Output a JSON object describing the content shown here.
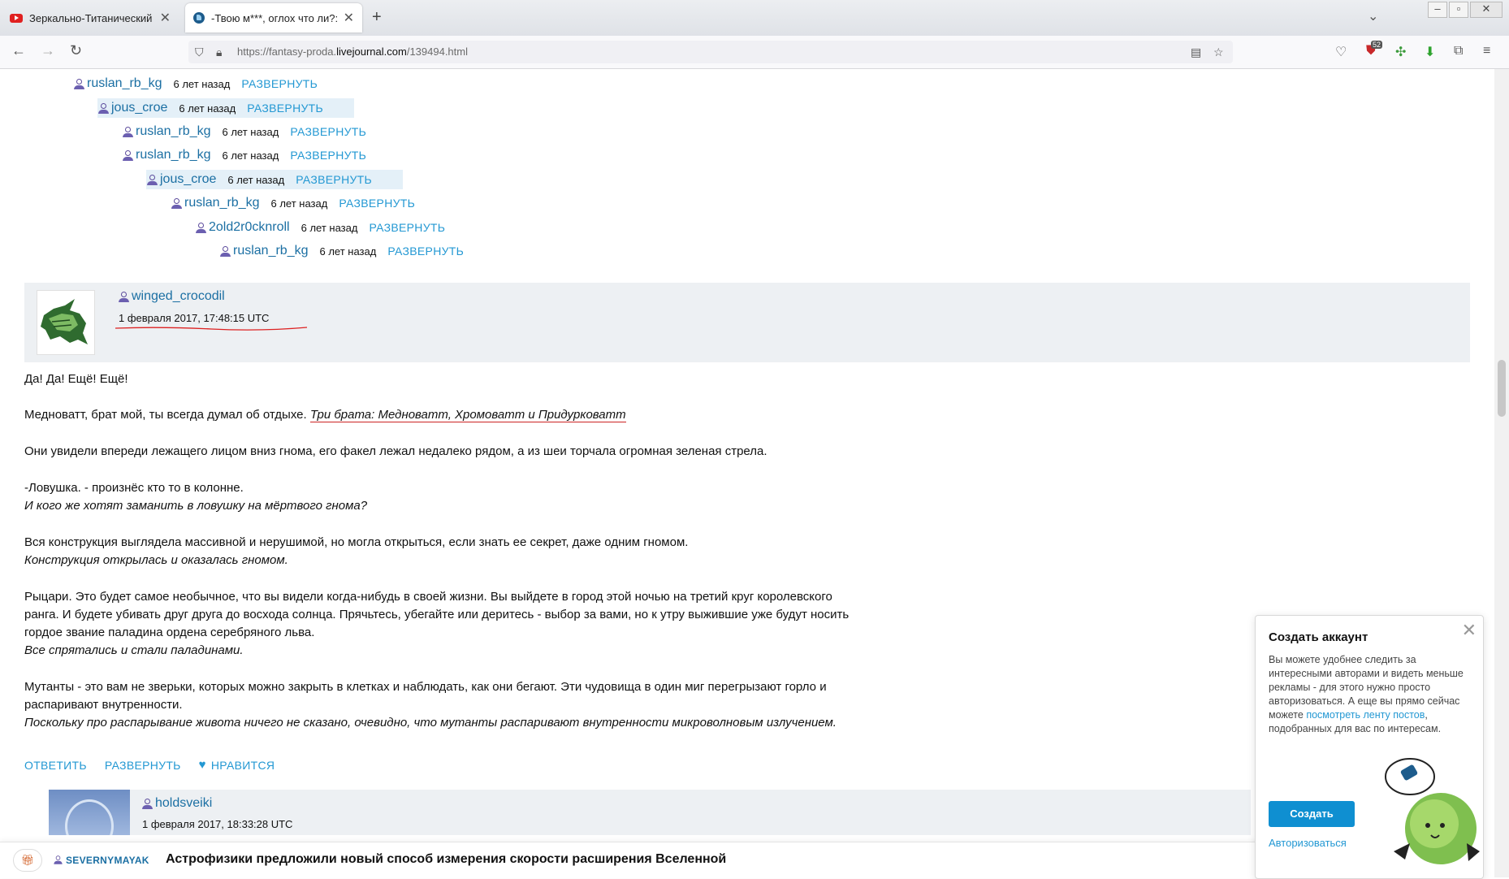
{
  "browser": {
    "tabs": [
      {
        "title": "Зеркально-Титанический Аут"
      },
      {
        "title": "-Твою м***, оглох что ли?: fan"
      }
    ],
    "url_prefix": "https://fantasy-proda.",
    "url_domain": "livejournal.com",
    "url_path": "/139494.html",
    "ext_badge": "52"
  },
  "thread": {
    "expand_label": "РАЗВЕРНУТЬ",
    "rows": [
      {
        "user": "ruslan_rb_kg",
        "ago": "6 лет назад"
      },
      {
        "user": "jous_croe",
        "ago": "6 лет назад"
      },
      {
        "user": "ruslan_rb_kg",
        "ago": "6 лет назад"
      },
      {
        "user": "ruslan_rb_kg",
        "ago": "6 лет назад"
      },
      {
        "user": "jous_croe",
        "ago": "6 лет назад"
      },
      {
        "user": "ruslan_rb_kg",
        "ago": "6 лет назад"
      },
      {
        "user": "2old2r0cknroll",
        "ago": "6 лет назад"
      },
      {
        "user": "ruslan_rb_kg",
        "ago": "6 лет назад"
      }
    ]
  },
  "comment": {
    "user": "winged_crocodil",
    "date": "1 февраля 2017, 17:48:15 UTC",
    "p1": "Да! Да! Ещё! Ещё!",
    "p2_plain": "Медноватт, брат мой, ты всегда думал об отдыхе. ",
    "p2_italic": "Три брата: Медноватт, Хромоватт и Придурковатт",
    "p3": "Они увидели впереди лежащего лицом вниз гнома, его факел лежал недалеко рядом, а из шеи торчала огромная зеленая стрела.",
    "p4a": "-Ловушка. - произнёс кто то в колонне.",
    "p4b": "И кого же хотят заманить в ловушку на мёртвого гнома?",
    "p5a": "Вся конструкция выглядела массивной и нерушимой, но могла открыться, если знать ее секрет, даже одним гномом.",
    "p5b": "Конструкция открылась и оказалась гномом.",
    "p6a": "Рыцари. Это будет самое необычное, что вы видели когда-нибудь в своей жизни. Вы выйдете в город этой ночью на третий круг королевского",
    "p6b": "ранга. И будете убивать друг друга до восхода солнца. Прячьтесь, убегайте или деритесь - выбор за вами, но к утру выжившие уже будут носить",
    "p6c": "гордое звание паладина ордена серебряного льва.",
    "p6d": "Все спрятались и стали паладинами.",
    "p7a": "Мутанты - это вам не зверьки, которых можно закрыть в клетках и наблюдать, как они бегают. Эти чудовища в один миг перегрызают горло и",
    "p7b": "распаривают внутренности.",
    "p7c": "Поскольку про распарывание живота ничего не сказано, очевидно, что мутанты распаривают внутренности микроволновым излучением.",
    "actions": {
      "reply": "ОТВЕТИТЬ",
      "expand": "РАЗВЕРНУТЬ",
      "like": "НРАВИТСЯ"
    }
  },
  "reply": {
    "user": "holdsveiki",
    "date": "1 февраля 2017, 18:33:28 UTC"
  },
  "bottom_bar": {
    "user": "SEVERNYMAYAK",
    "title": "Астрофизики предложили новый способ измерения скорости расширения Вселенной"
  },
  "popup": {
    "title": "Создать аккаунт",
    "body_1": "Вы можете удобнее следить за интересными авторами и видеть меньше рекламы - для этого нужно просто авторизоваться. А еще вы прямо сейчас можете ",
    "body_link": "посмотреть ленту постов",
    "body_2": ", подобранных для вас по интересам.",
    "create_button": "Создать",
    "login_link": "Авторизоваться"
  }
}
